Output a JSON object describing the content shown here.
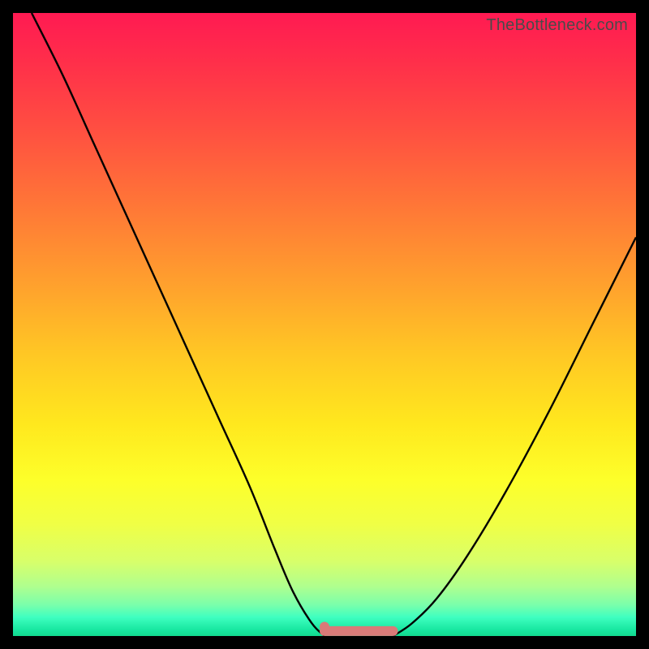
{
  "watermark": "TheBottleneck.com",
  "chart_data": {
    "type": "line",
    "title": "",
    "xlabel": "",
    "ylabel": "",
    "xlim": [
      0,
      100
    ],
    "ylim": [
      0,
      100
    ],
    "series": [
      {
        "name": "left-curve",
        "x": [
          3,
          8,
          13,
          18,
          23,
          28,
          33,
          38,
          42,
          45,
          48,
          50
        ],
        "values": [
          100,
          90,
          79,
          68,
          57,
          46,
          35,
          24,
          14,
          7,
          2,
          0
        ]
      },
      {
        "name": "right-curve",
        "x": [
          61,
          64,
          68,
          73,
          79,
          86,
          93,
          100
        ],
        "values": [
          0,
          2,
          6,
          13,
          23,
          36,
          50,
          64
        ]
      },
      {
        "name": "flat-highlight",
        "x": [
          50,
          52,
          54,
          56,
          58,
          60,
          61
        ],
        "values": [
          0,
          0,
          0,
          0,
          0,
          0,
          0
        ]
      }
    ],
    "colors": {
      "curve": "#000000",
      "highlight": "#d97a78",
      "highlight_dot": "#d97a78"
    },
    "highlight_dot": {
      "x": 50,
      "y": 1.5
    }
  }
}
